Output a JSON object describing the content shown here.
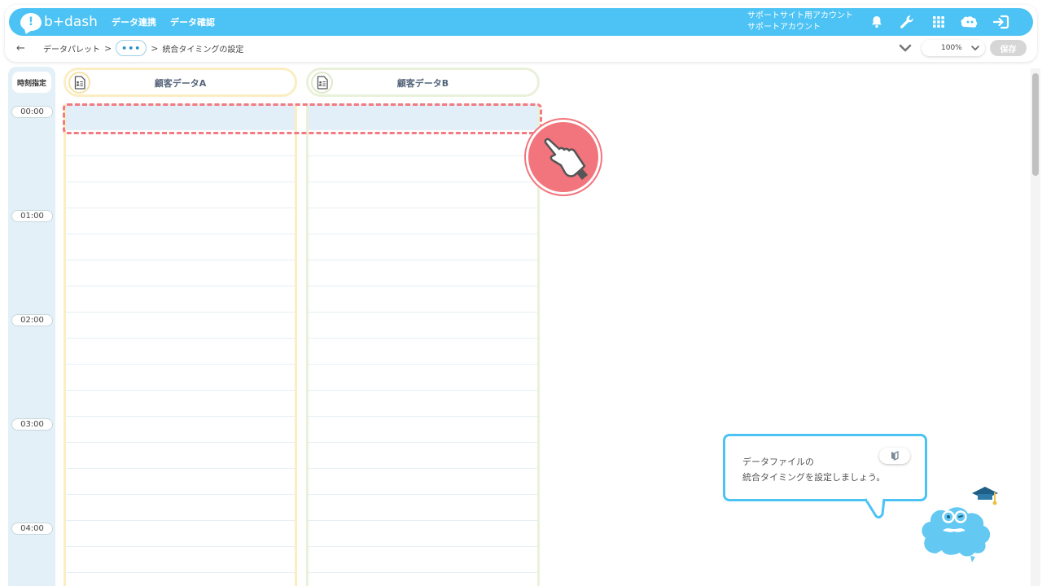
{
  "header": {
    "logo_text": "b+dash",
    "nav": [
      "データ連携",
      "データ確認"
    ],
    "account_lines": [
      "サポートサイト用アカウント",
      "サポートアカウント"
    ],
    "icons": [
      "bell-icon",
      "wrench-icon",
      "apps-grid-icon",
      "user-avatar-icon",
      "logout-icon"
    ],
    "brand_color": "#4cc3f4"
  },
  "breadcrumb": {
    "back_glyph": "←",
    "items": [
      "データパレット",
      "•••",
      "統合タイミングの設定"
    ],
    "separator": ">"
  },
  "toolbar": {
    "zoom": "100%",
    "save_label": "保存"
  },
  "time_axis": {
    "header": "時刻指定",
    "labels": [
      "00:00",
      "01:00",
      "02:00",
      "03:00",
      "04:00"
    ]
  },
  "columns": [
    {
      "title": "顧客データA",
      "icon": "document-icon",
      "accent": "#fbeec3"
    },
    {
      "title": "顧客データB",
      "icon": "document-icon",
      "accent": "#eaf1da"
    }
  ],
  "highlight_color": "#f27a80",
  "help": {
    "lines": [
      "データファイルの",
      "統合タイミングを設定しましょう。"
    ],
    "toggle_icon": "beginner-mark-icon",
    "mascot": "cloud-mascot-icon"
  }
}
